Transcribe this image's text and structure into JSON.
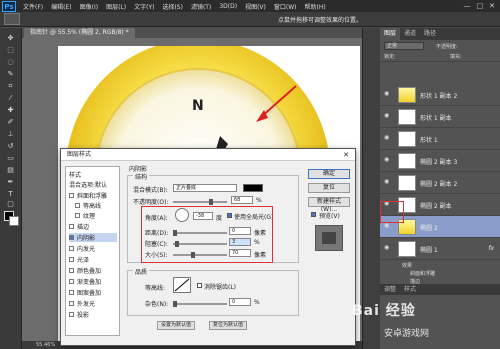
{
  "menubar": {
    "logo": "Ps",
    "items": [
      "文件(F)",
      "编辑(E)",
      "图像(I)",
      "图层(L)",
      "文字(Y)",
      "选择(S)",
      "滤镜(T)",
      "3D(D)",
      "视图(V)",
      "窗口(W)",
      "帮助(H)"
    ],
    "controls": [
      "—",
      "□",
      "✕"
    ]
  },
  "options_bar": {
    "hint": "点鼠并拖移可调整效果的位置。"
  },
  "document": {
    "tab_title": "指南针 @ 55.5% (椭圆 2, RGB/8) *",
    "zoom": "55.46%",
    "compass_letter": "N"
  },
  "layers_panel": {
    "tabs": [
      "图层",
      "通道",
      "路径"
    ],
    "blend_mode": "正常",
    "opacity_label": "不透明度:",
    "lock_label": "锁定:",
    "fill_label": "填充:",
    "layers": [
      {
        "name": "形状 1 副本 2"
      },
      {
        "name": "形状 1 副本"
      },
      {
        "name": "形状 1"
      },
      {
        "name": "椭圆 2 副本 3"
      },
      {
        "name": "椭圆 2 副本 2"
      },
      {
        "name": "椭圆 2 副本"
      },
      {
        "name": "椭圆 2"
      },
      {
        "name": "椭圆 1",
        "fx": "fx"
      }
    ],
    "effects_label": "效果",
    "effects": [
      "斜面和浮雕",
      "描边"
    ],
    "bottom_tabs": [
      "调整",
      "样式"
    ]
  },
  "dialog": {
    "title": "图层样式",
    "close": "✕",
    "styles_header": "样式",
    "blend_options": "混合选项:默认",
    "style_items": [
      {
        "label": "斜面和浮雕",
        "checked": false
      },
      {
        "label": "等高线",
        "checked": false
      },
      {
        "label": "纹理",
        "checked": false
      },
      {
        "label": "描边",
        "checked": false
      },
      {
        "label": "内阴影",
        "checked": true,
        "selected": true
      },
      {
        "label": "内发光",
        "checked": false
      },
      {
        "label": "光泽",
        "checked": false
      },
      {
        "label": "颜色叠加",
        "checked": false
      },
      {
        "label": "渐变叠加",
        "checked": false
      },
      {
        "label": "图案叠加",
        "checked": false
      },
      {
        "label": "外发光",
        "checked": false
      },
      {
        "label": "投影",
        "checked": false
      }
    ],
    "section_title": "内阴影",
    "structure_label": "结构",
    "blend_mode_label": "混合模式(B):",
    "blend_mode_value": "正片叠底",
    "opacity_label": "不透明度(O):",
    "opacity_value": "68",
    "angle_label": "角度(A):",
    "angle_value": "-38",
    "angle_unit": "度",
    "global_light_label": "使用全局光(G)",
    "distance_label": "距离(D):",
    "distance_value": "0",
    "choke_label": "阻塞(C):",
    "choke_value": "3",
    "size_label": "大小(S):",
    "size_value": "70",
    "unit_px": "像素",
    "unit_pct": "%",
    "quality_label": "品质",
    "contour_label": "等高线:",
    "antialias_label": "消除锯齿(L)",
    "noise_label": "杂色(N):",
    "noise_value": "0",
    "default_btn": "设置为默认值",
    "reset_btn": "复位为默认值",
    "ok": "确定",
    "cancel": "复位",
    "new_style": "新建样式(W)...",
    "preview": "预览(V)"
  },
  "watermark": {
    "main": "Bai 经验",
    "sub": "安卓游戏网"
  }
}
